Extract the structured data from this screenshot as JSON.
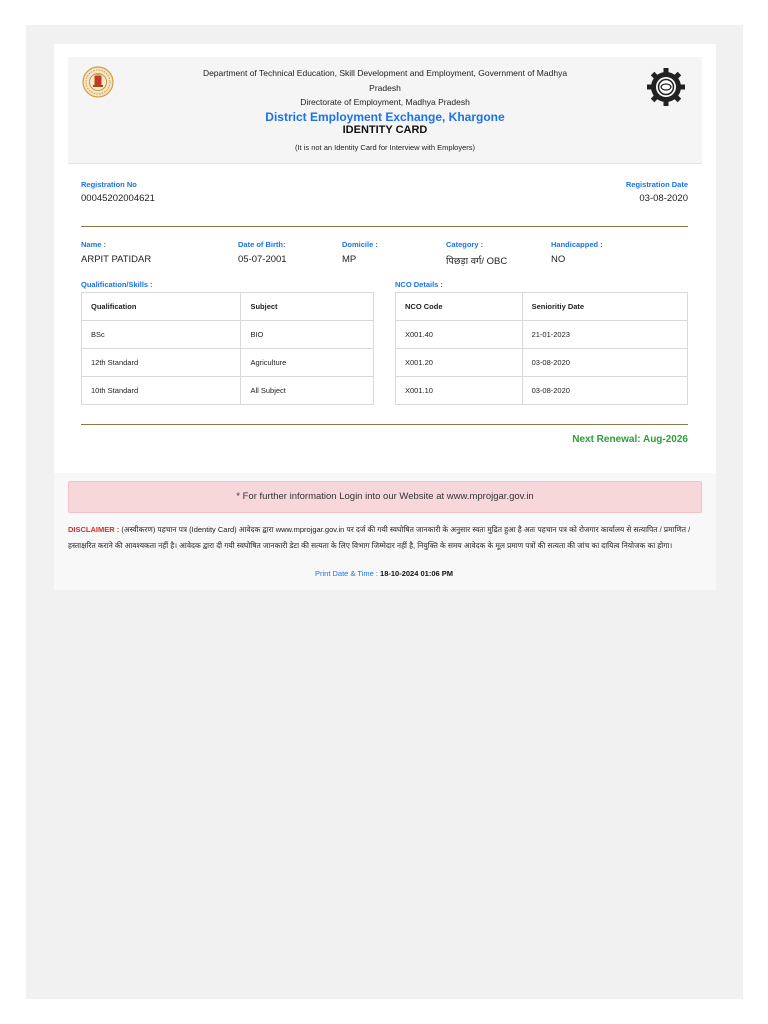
{
  "header": {
    "department": "Department of Technical Education, Skill Development and Employment, Government of Madhya Pradesh",
    "directorate": "Directorate of Employment, Madhya Pradesh",
    "exchange": "District Employment Exchange, Khargone",
    "card_title": "IDENTITY CARD",
    "note": "(It is not an Identity Card for Interview with Employers)"
  },
  "registration": {
    "no_label": "Registration No",
    "no_value": "00045202004621",
    "date_label": "Registration Date",
    "date_value": "03-08-2020"
  },
  "personal": {
    "name_label": "Name :",
    "name_value": "ARPIT PATIDAR",
    "dob_label": "Date of Birth:",
    "dob_value": "05-07-2001",
    "domicile_label": "Domicile :",
    "domicile_value": "MP",
    "category_label": "Category :",
    "category_value": "पिछड़ा वर्ग/ OBC",
    "handicapped_label": "Handicapped :",
    "handicapped_value": "NO"
  },
  "qualification": {
    "section_label": "Qualification/Skills :",
    "headers": [
      "Qualification",
      "Subject"
    ],
    "rows": [
      [
        "BSc",
        "BIO"
      ],
      [
        "12th Standard",
        "Agriculture"
      ],
      [
        "10th Standard",
        "All Subject"
      ]
    ]
  },
  "nco": {
    "section_label": "NCO Details :",
    "headers": [
      "NCO Code",
      "Senioritiy Date"
    ],
    "rows": [
      [
        "X001.40",
        "21-01-2023"
      ],
      [
        "X001.20",
        "03-08-2020"
      ],
      [
        "X001.10",
        "03-08-2020"
      ]
    ]
  },
  "renewal": "Next Renewal: Aug-2026",
  "info": "* For further information Login into our Website at www.mprojgar.gov.in",
  "disclaimer": {
    "label": "DISCLAIMER :",
    "text": "(अस्वीकरण) पहचान पत्र (Identity Card) आवेदक द्वारा www.mprojgar.gov.in पर दर्ज की गयी स्वघोषित जानकारी के अनुसार स्वतः मुद्रित हुआ है अतः पहचान पत्र को रोजगार कार्यालय से सत्यापित / प्रमाणित / हस्ताक्षरित कराने की आवश्यकता नहीं है। आवेदक द्वारा दी गयी स्वघोषित जानकारी डेटा की सत्यता के लिए विभाग जिम्मेदार नहीं है, नियुक्ति के समय आवेदक के मूल प्रमाण पत्रों की सत्यता की जांच का दायित्व नियोजक का होगा।"
  },
  "print": {
    "label": "Print Date & Time :",
    "value": "18-10-2024 01:06 PM"
  },
  "colors": {
    "accent_blue": "#1a73e8",
    "renewal_green": "#2e9e3a",
    "info_bg": "#f8d7da",
    "disclaimer_red": "#d32f2f"
  }
}
